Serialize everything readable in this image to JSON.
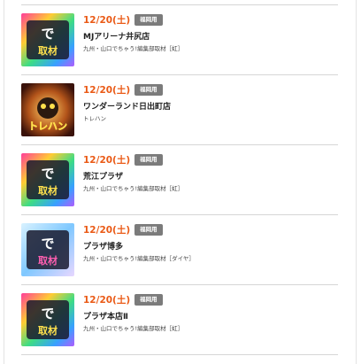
{
  "items": [
    {
      "date": "12/20(土)",
      "badge": "福岡用",
      "store": "MJアリーナ井尻店",
      "sub": "九州・山口でちゃう!編集部取材［虹］",
      "thumb": "dechau-logo"
    },
    {
      "date": "12/20(土)",
      "badge": "福岡用",
      "store": "ワンダーランド日出町店",
      "sub": "トレハン",
      "thumb": "trehan-logo"
    },
    {
      "date": "12/20(土)",
      "badge": "福岡用",
      "store": "荒江プラザ",
      "sub": "九州・山口でちゃう!編集部取材［虹］",
      "thumb": "dechau-logo"
    },
    {
      "date": "12/20(土)",
      "badge": "福岡用",
      "store": "プラザ博多",
      "sub": "九州・山口でちゃう!編集部取材［ダイヤ］",
      "thumb": "dechau-logo-diamond"
    },
    {
      "date": "12/20(土)",
      "badge": "福岡用",
      "store": "プラザ本店Ⅱ",
      "sub": "九州・山口でちゃう!編集部取材［虹］",
      "thumb": "dechau-logo"
    }
  ],
  "colors": {
    "date": "#ea5a16",
    "badge_bg": "#7b7b7b",
    "divider": "#d6d6d6"
  }
}
